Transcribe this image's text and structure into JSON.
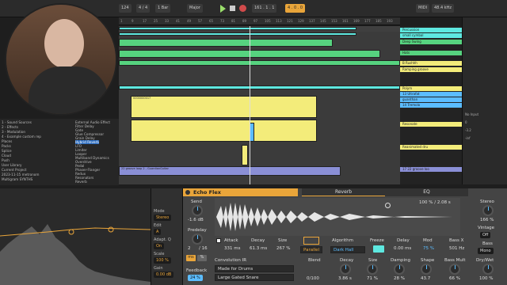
{
  "colors": {
    "accent": "#e9a53a",
    "blue": "#5bbcff",
    "clip_yellow": "#f3ec7a",
    "clip_cyan": "#5ee8e0",
    "clip_green": "#56d37f",
    "clip_purple": "#8a8fd6"
  },
  "transport": {
    "tempo": "124",
    "time_sig": "4 / 4",
    "bar": "1 Bar",
    "key": "Major",
    "position": "161 . 1 . 1",
    "loop_end": "4 . 0 . 0",
    "cpu": "MIDI",
    "load": "48.4 kHz",
    "zoom": "100 %"
  },
  "ruler": {
    "marks": [
      "1",
      "9",
      "17",
      "25",
      "33",
      "41",
      "49",
      "57",
      "65",
      "73",
      "81",
      "89",
      "97",
      "105",
      "113",
      "121",
      "129",
      "137",
      "145",
      "153",
      "161",
      "169",
      "177",
      "185",
      "193"
    ]
  },
  "browser": {
    "places_title": "Places",
    "left_items": [
      "1 - Sound Sources",
      "2 - Effects",
      "3 - Modulation",
      "4 - Example custom rep",
      "Places",
      "Packs",
      "Splice",
      "Cloud",
      "Push",
      "User Library",
      "Current Project",
      "2023-11-15 metronom",
      "Multigram SYNTHS"
    ],
    "right_items": [
      "External Audio Effect",
      "Filter Delay",
      "Gate",
      "Glue Compressor",
      "Grain Delay",
      "Hybrid Reverb",
      "LFO",
      "Limiter",
      "Looper",
      "Multiband Dynamics",
      "Overdrive",
      "Pedal",
      "Phaser-Flanger",
      "Redux",
      "Resonators",
      "Reverb"
    ],
    "selected": "Hybrid Reverb"
  },
  "tracks": [
    {
      "name": "Percussion",
      "color": "#5ee8e0"
    },
    {
      "name": "small cymbal",
      "color": "#5ee8e0"
    },
    {
      "name": "Deep Swing",
      "color": "#56d37f"
    },
    {
      "name": "Hats",
      "color": "#56d37f"
    },
    {
      "name": "B Rushhh",
      "color": "#f3ec7a"
    },
    {
      "name": "Ramping groove",
      "color": "#f3ec7a"
    },
    {
      "name": "Polym",
      "color": "#f3ec7a"
    },
    {
      "name": "13 Ultrafat",
      "color": "#5bbcff"
    },
    {
      "name": "guanthan",
      "color": "#5bbcff"
    },
    {
      "name": "14 Tremolo",
      "color": "#5bbcff"
    },
    {
      "name": "Resonate",
      "color": "#f3ec7a"
    },
    {
      "name": "Reanimated dru",
      "color": "#f3ec7a"
    },
    {
      "name": "17 22 groove loo",
      "color": "#8a8fd6"
    }
  ],
  "mixer": {
    "in_label": "No Input",
    "sends": [
      "A",
      "B"
    ],
    "values": [
      "0",
      "-3.2",
      "-inf"
    ]
  },
  "clip_names": {
    "loop": "22 groove loop 2 - GuardianGuitar",
    "audio": "0000000017"
  },
  "reverb_device": {
    "mode_label": "Mode",
    "mode_value": "Stereo",
    "edit_label": "Edit",
    "edit_value": "A",
    "adapt_label": "Adapt. Q",
    "adapt_value": "On",
    "scale_label": "Scale",
    "scale_value": "100 %",
    "gain_label": "Gain",
    "gain_value": "0.00 dB"
  },
  "device": {
    "title": "Echo Flex",
    "tabs": [
      "Reverb",
      "EQ"
    ],
    "active_tab": "Reverb",
    "send_label": "Send",
    "send_value": "-1.6 dB",
    "predelay_label": "Predelay",
    "predelay_value": "2",
    "predelay_div": "/ 16",
    "ms_label": "ms",
    "pct_label": "%",
    "feedback_label": "Feedback",
    "feedback_value": "24 %",
    "wave_info": "100 % / 2.08 s",
    "attack_label": "Attack",
    "attack_value": "331 ms",
    "decay_label": "Decay",
    "decay_value": "61.3 ms",
    "size_label": "Size",
    "size_value": "267 %",
    "routing_value": "Parallel",
    "algorithm_label": "Algorithm",
    "algorithm_value": "Dark Hall",
    "freeze_label": "Freeze",
    "delay_label": "Delay",
    "delay_value": "0.00 ms",
    "mod_label": "Mod",
    "mod_value": "75 %",
    "bassx_label": "Bass X",
    "bassx_value": "501 Hz",
    "ir_label": "Convolution IR",
    "ir_category": "Made for Drums",
    "ir_name": "Large Gated Snare",
    "blend_label": "Blend",
    "blend_value": "0/100",
    "decay2_label": "Decay",
    "decay2_value": "3.86 s",
    "size2_label": "Size",
    "size2_value": "71 %",
    "damping_label": "Damping",
    "damping_value": "28 %",
    "shape_label": "Shape",
    "shape_value": "43.7",
    "bassmult_label": "Bass Mult",
    "bassmult_value": "66 %",
    "stereo_label": "Stereo",
    "stereo_value": "166 %",
    "vintage_label": "Vintage",
    "vintage_value": "Off",
    "bass_label": "Bass",
    "bass_value": "Mono",
    "drywet_label": "Dry/Wet",
    "drywet_value": "100 %"
  }
}
